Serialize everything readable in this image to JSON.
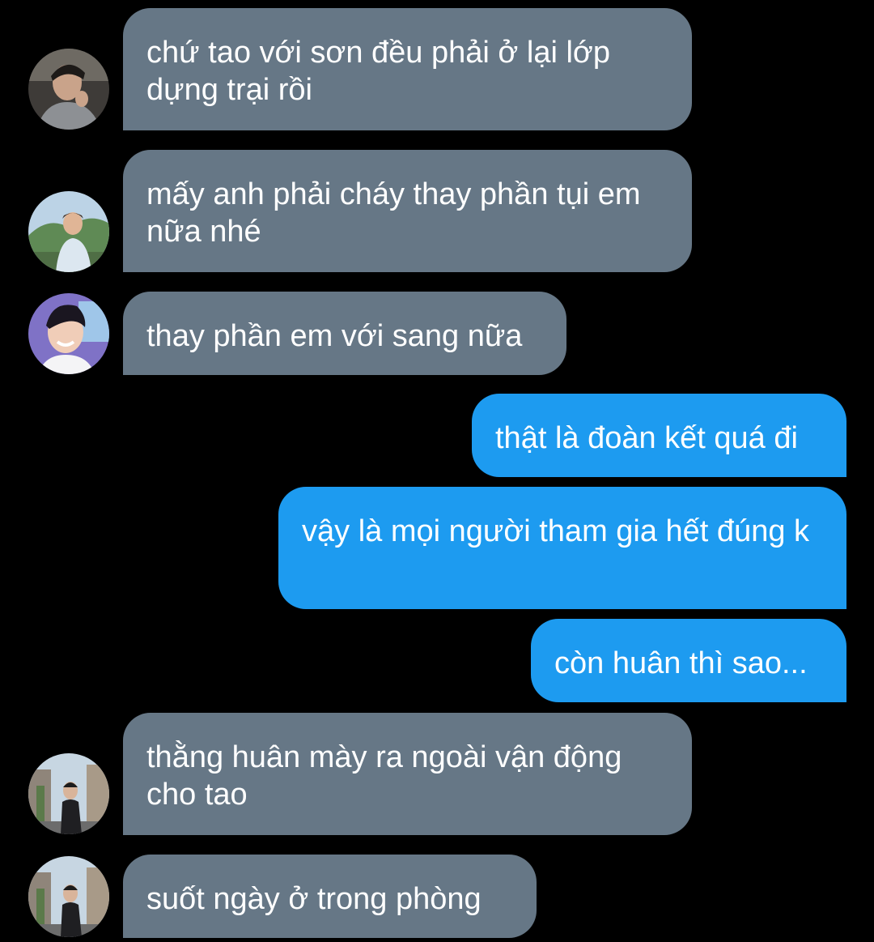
{
  "messages": [
    {
      "side": "incoming",
      "text": "chứ tao với sơn đều phải ở lại lớp dựng trại rồi",
      "avatar": "avatar-person-grey-jacket"
    },
    {
      "side": "incoming",
      "text": "mấy anh phải cháy thay phần tụi em nữa nhé",
      "avatar": "avatar-person-outdoors-hills"
    },
    {
      "side": "incoming",
      "text": "thay phần em với sang nữa",
      "avatar": "avatar-person-smiling-purple"
    },
    {
      "side": "outgoing",
      "text": "thật là đoàn kết quá đi"
    },
    {
      "side": "outgoing",
      "text": "vậy là mọi người tham gia hết đúng k"
    },
    {
      "side": "outgoing",
      "text": "còn huân thì sao..."
    },
    {
      "side": "incoming",
      "text": "thằng huân mày ra ngoài vận động cho tao",
      "avatar": "avatar-person-street"
    },
    {
      "side": "incoming",
      "text": "suốt ngày ở trong phòng",
      "avatar": "avatar-person-street"
    }
  ],
  "colors": {
    "background": "#000000",
    "incoming_bubble": "#667786",
    "outgoing_bubble": "#1d9bf0",
    "text": "#ffffff"
  }
}
